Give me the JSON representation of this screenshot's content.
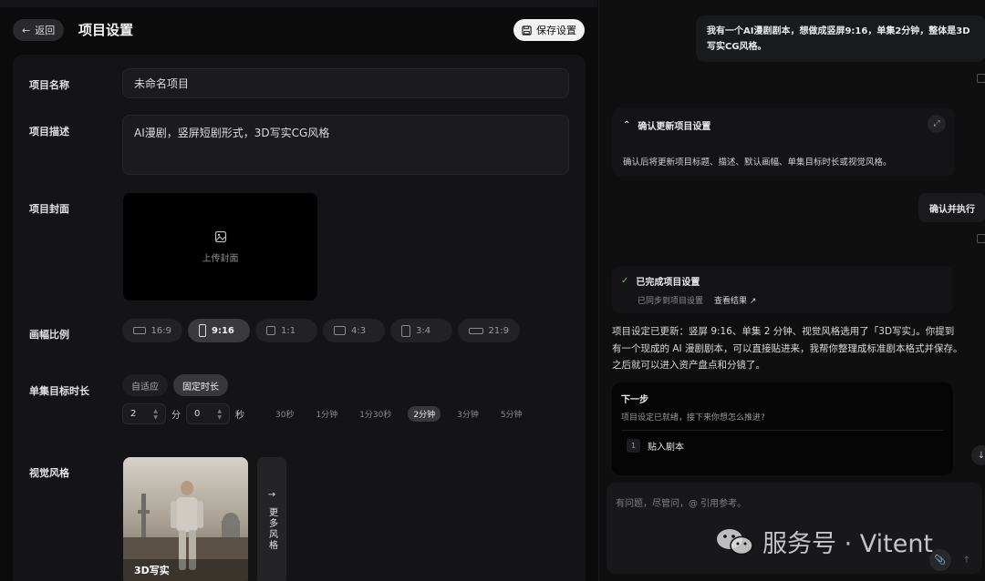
{
  "header": {
    "back_label": "返回",
    "title": "项目设置",
    "save_label": "保存设置"
  },
  "form": {
    "name": {
      "label": "项目名称",
      "value": "未命名项目"
    },
    "desc": {
      "label": "项目描述",
      "value": "AI漫剧，竖屏短剧形式，3D写实CG风格"
    },
    "cover": {
      "label": "项目封面",
      "upload_label": "上传封面"
    },
    "ratio": {
      "label": "画幅比例",
      "options": [
        "16:9",
        "9:16",
        "1:1",
        "4:3",
        "3:4",
        "21:9"
      ],
      "selected": "9:16"
    },
    "duration": {
      "label": "单集目标时长",
      "modes": [
        "自适应",
        "固定时长"
      ],
      "selected_mode": "固定时长",
      "minutes": "2",
      "minutes_unit": "分",
      "seconds": "0",
      "seconds_unit": "秒",
      "quick": [
        "30秒",
        "1分钟",
        "1分30秒",
        "2分钟",
        "3分钟",
        "5分钟"
      ],
      "selected_quick": "2分钟"
    },
    "style": {
      "label": "视觉风格",
      "selected_name": "3D写实",
      "more_label": "更多风格"
    }
  },
  "chat": {
    "user_message": "我有一个AI漫剧剧本，想做成竖屏9:16，单集2分钟，整体是3D写实CG风格。",
    "confirm_card": {
      "title": "确认更新项目设置",
      "desc": "确认后将更新项目标题、描述、默认画幅、单集目标时长或视觉风格。"
    },
    "exec_label": "确认并执行",
    "done_card": {
      "title": "已完成项目设置",
      "sub": "已同步到项目设置",
      "link": "查看结果 ↗"
    },
    "reply": "项目设定已更新：竖屏 9:16、单集 2 分钟、视觉风格选用了「3D写实」。你提到有一个现成的 AI 漫剧剧本，可以直接贴进来，我帮你整理成标准剧本格式并保存。之后就可以进入资产盘点和分镜了。",
    "next": {
      "title": "下一步",
      "sub": "项目设定已就绪，接下来你想怎么推进?",
      "option_num": "1",
      "option_label": "贴入剧本"
    },
    "composer_placeholder": "有问题，尽管问，@ 引用参考。"
  },
  "watermark": {
    "text": "服务号 · Vitent"
  }
}
